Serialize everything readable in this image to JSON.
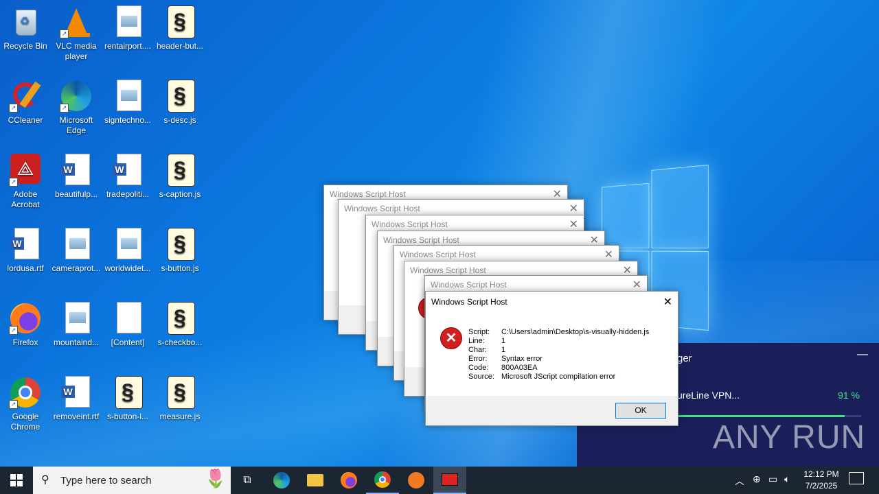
{
  "desktop": {
    "icons": [
      {
        "label": "Recycle Bin"
      },
      {
        "label": "VLC media player"
      },
      {
        "label": "rentairport...."
      },
      {
        "label": "header-but..."
      },
      {
        "label": "CCleaner"
      },
      {
        "label": "Microsoft Edge"
      },
      {
        "label": "signtechno..."
      },
      {
        "label": "s-desc.js"
      },
      {
        "label": "Adobe Acrobat"
      },
      {
        "label": "beautifulp..."
      },
      {
        "label": "tradepoliti..."
      },
      {
        "label": "s-caption.js"
      },
      {
        "label": "lordusa.rtf"
      },
      {
        "label": "cameraprot..."
      },
      {
        "label": "worldwidet..."
      },
      {
        "label": "s-button.js"
      },
      {
        "label": "Firefox"
      },
      {
        "label": "mountaind..."
      },
      {
        "label": "[Content]"
      },
      {
        "label": "s-checkbo..."
      },
      {
        "label": "Google Chrome"
      },
      {
        "label": "removeint.rtf"
      },
      {
        "label": "s-button-l..."
      },
      {
        "label": "measure.js"
      }
    ]
  },
  "dialogs": {
    "back_title": "Windows Script Host",
    "front": {
      "title": "Windows Script Host",
      "close": "✕",
      "fields": [
        {
          "key": "Script:",
          "value": "C:\\Users\\admin\\Desktop\\s-visually-hidden.js"
        },
        {
          "key": "Line:",
          "value": "1"
        },
        {
          "key": "Char:",
          "value": "1"
        },
        {
          "key": "Error:",
          "value": "Syntax error"
        },
        {
          "key": "Code:",
          "value": "800A03EA"
        },
        {
          "key": "Source:",
          "value": "Microsoft JScript compilation error"
        }
      ],
      "ok_label": "OK"
    }
  },
  "vpn_panel": {
    "title_fragment": "ger",
    "minimize": "—",
    "item_name": "ureLine VPN...",
    "progress_text": "91 %",
    "progress": 0.91,
    "watermark": "ANY RUN"
  },
  "taskbar": {
    "search_placeholder": "Type here to search",
    "time": "12:12 PM",
    "date": "7/2/2025"
  }
}
